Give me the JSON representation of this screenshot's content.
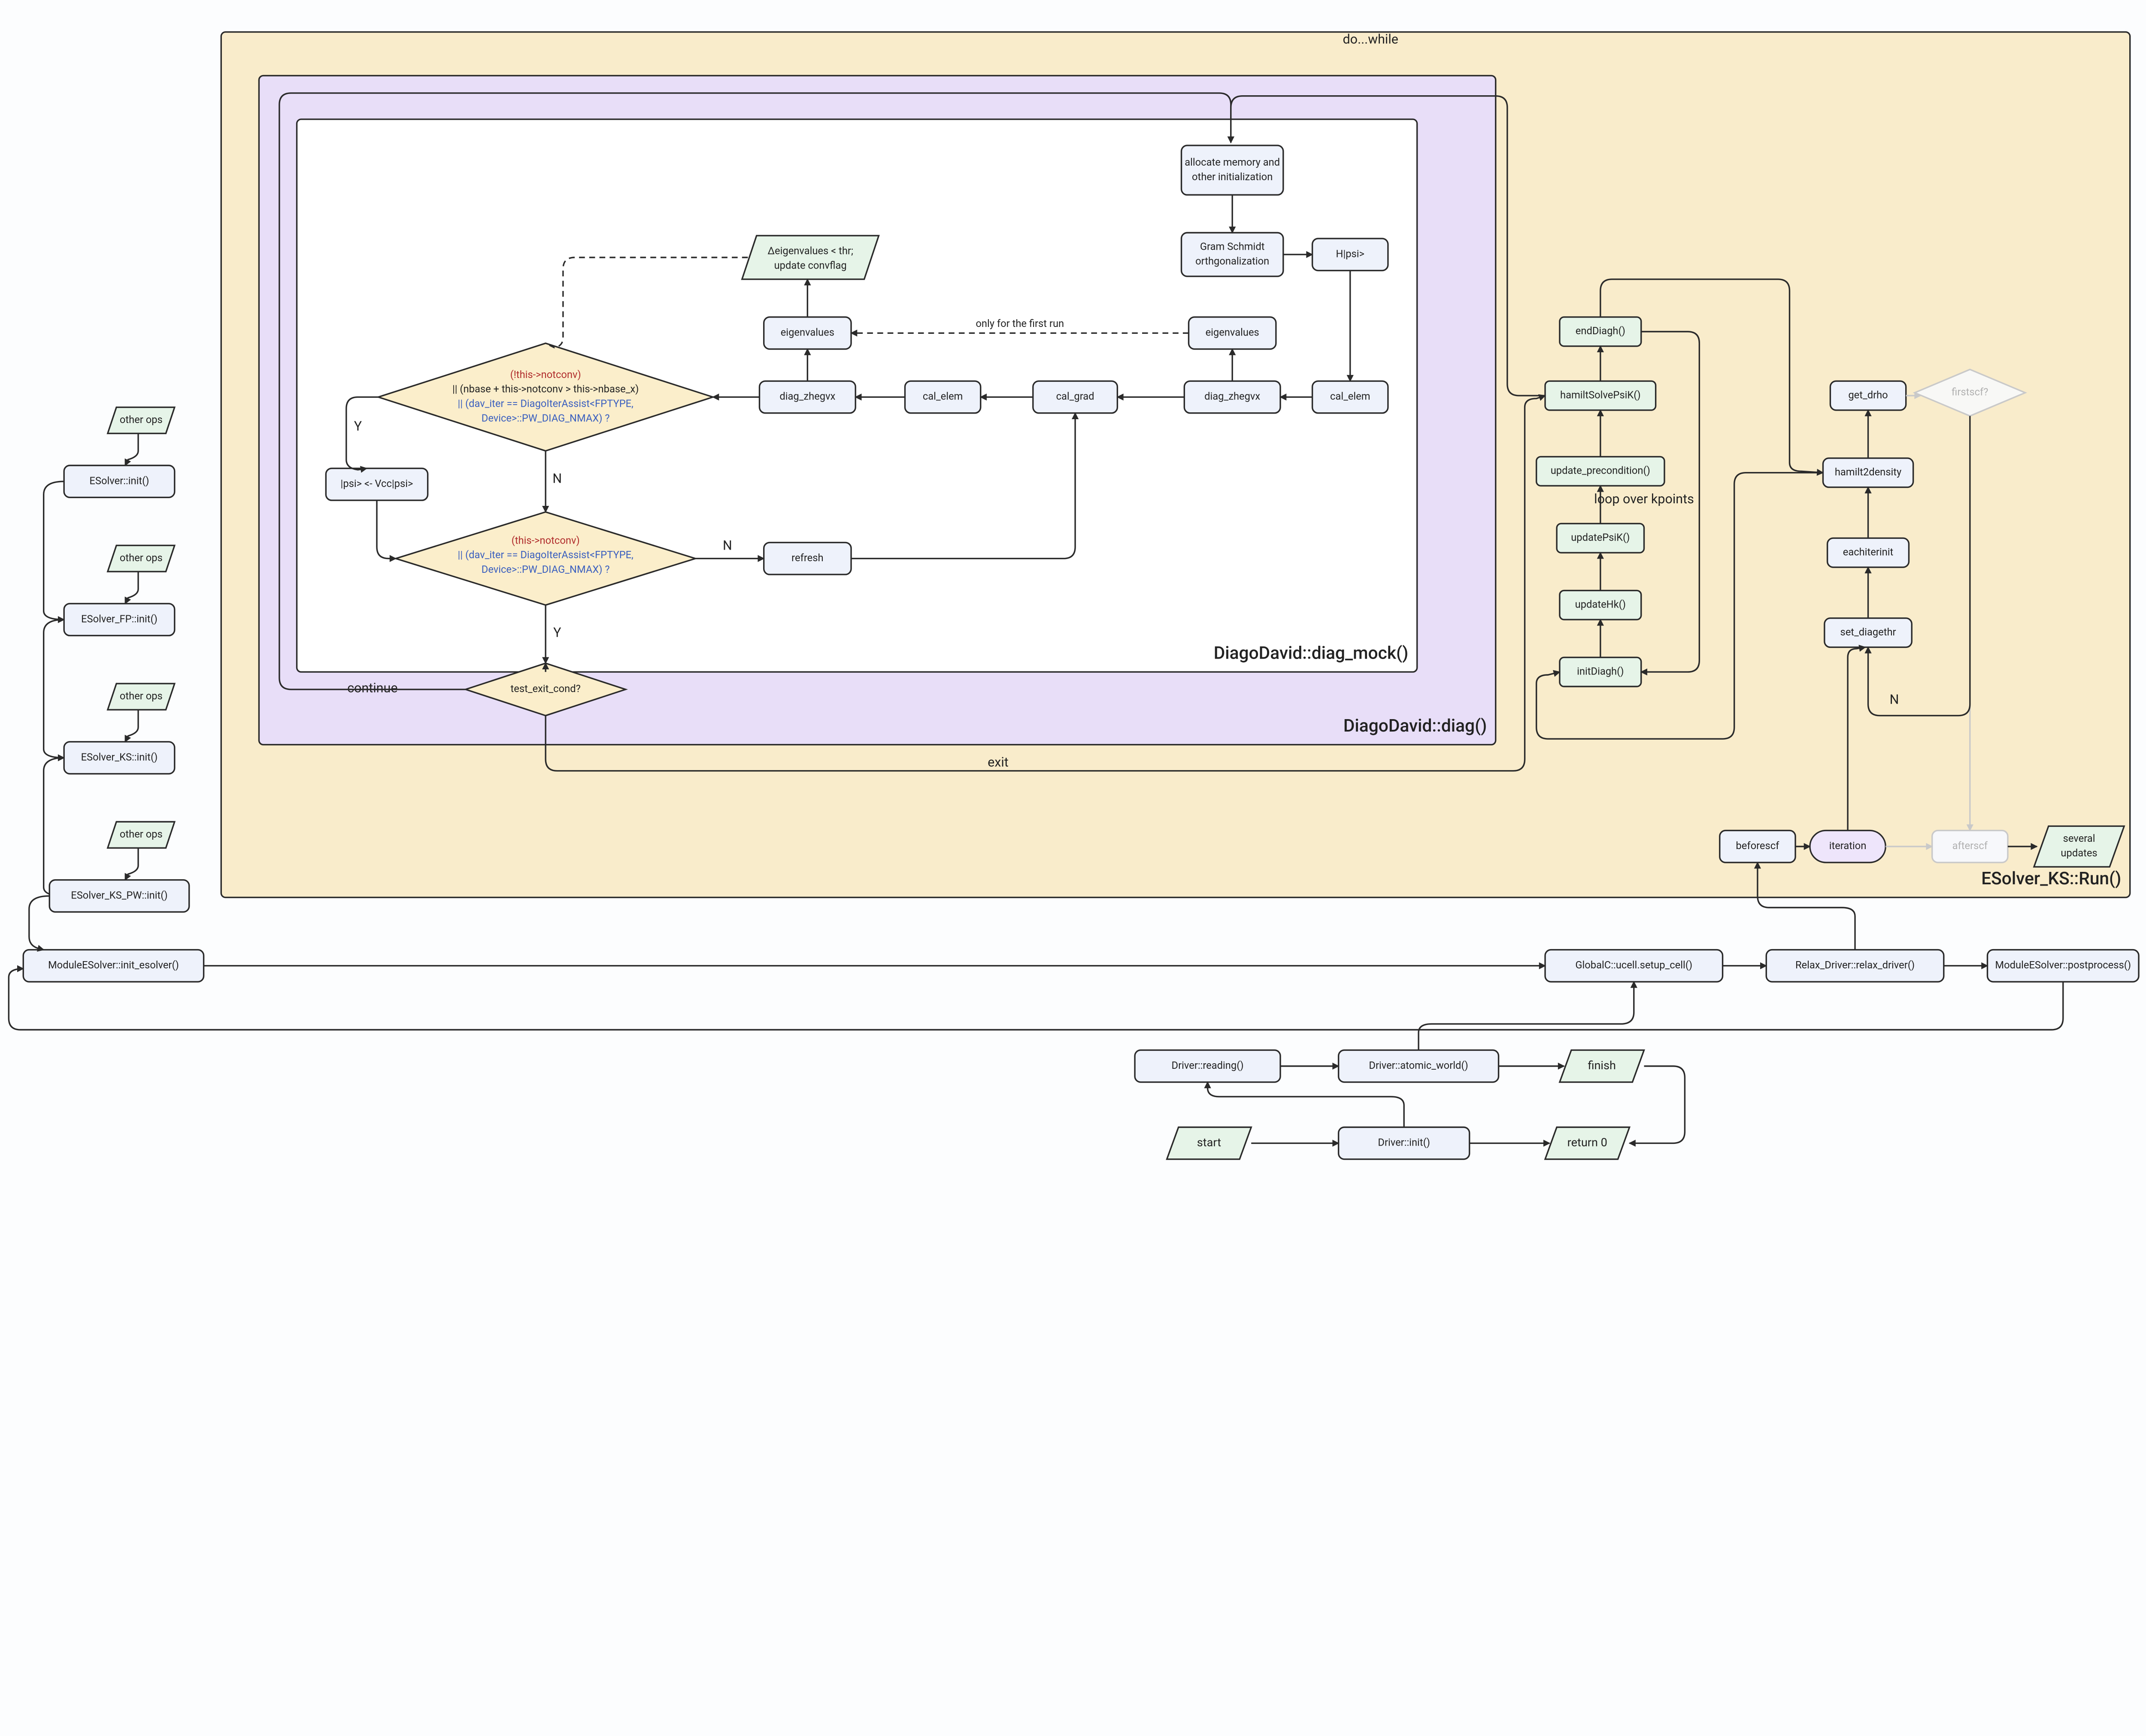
{
  "containers": {
    "yellow_title": "ESolver_KS::Run()",
    "purple_title": "DiagoDavid::diag()",
    "white_title": "DiagoDavid::diag_mock()"
  },
  "left_chain": {
    "ops1": "other ops",
    "init1": "ESolver::init()",
    "ops2": "other ops",
    "init2": "ESolver_FP::init()",
    "ops3": "other ops",
    "init3": "ESolver_KS::init()",
    "ops4": "other ops",
    "init4": "ESolver_KS_PW::init()",
    "mod_init": "ModuleESolver::init_esolver()"
  },
  "bottom_row": {
    "setup_cell": "GlobalC::ucell.setup_cell()",
    "relax_driver": "Relax_Driver::relax_driver()",
    "postprocess": "ModuleESolver::postprocess()"
  },
  "driver": {
    "start": "start",
    "drv_init": "Driver::init()",
    "return0": "return 0",
    "reading": "Driver::reading()",
    "atomic_world": "Driver::atomic_world()",
    "finish": "finish"
  },
  "yellow_inner": {
    "beforescf": "beforescf",
    "iteration": "iteration",
    "afterscf": "afterscf",
    "several_updates": "several updates",
    "firstscf": "firstscf?",
    "get_drho": "get_drho",
    "hamilt2density": "hamilt2density",
    "eachiterinit": "eachiterinit",
    "set_diagethr": "set_diagethr",
    "loop_kpoints": "loop over kpoints",
    "endDiagh": "endDiagh()",
    "hamiltSolvePsiK": "hamiltSolvePsiK()",
    "update_precond": "update_precondition()",
    "updatePsiK": "updatePsiK()",
    "updateHk": "updateHk()",
    "initDiagh": "initDiagh()"
  },
  "diag": {
    "test_exit": "test_exit_cond?",
    "continue": "continue",
    "exit": "exit",
    "do_while": "do...while"
  },
  "mock": {
    "alloc": "allocate memory and other initialization",
    "gram": "Gram Schmidt orthgonalization",
    "hpsi": "H|psi>",
    "eigenvalues_r": "eigenvalues",
    "diag_zhegvx_r": "diag_zhegvx",
    "cal_elem_r": "cal_elem",
    "cal_grad": "cal_grad",
    "cal_elem_l": "cal_elem",
    "diag_zhegvx_l": "diag_zhegvx",
    "eigenvalues_l": "eigenvalues",
    "delta_eig_a": "Δeigenvalues < thr;",
    "delta_eig_b": "update convflag",
    "only_first": "only for the first run",
    "psi_vcc": "|psi> <- Vcc|psi>",
    "refresh": "refresh",
    "Y": "Y",
    "N": "N",
    "cond1_a": "(!this->notconv)",
    "cond1_b": "|| (nbase + this->notconv > this->nbase_x)",
    "cond1_c": "|| (dav_iter == DiagoIterAssist<FPTYPE,",
    "cond1_d": "Device>::PW_DIAG_NMAX) ?",
    "cond2_a": "(this->notconv)",
    "cond2_b": "|| (dav_iter == DiagoIterAssist<FPTYPE,",
    "cond2_c": "Device>::PW_DIAG_NMAX) ?"
  }
}
